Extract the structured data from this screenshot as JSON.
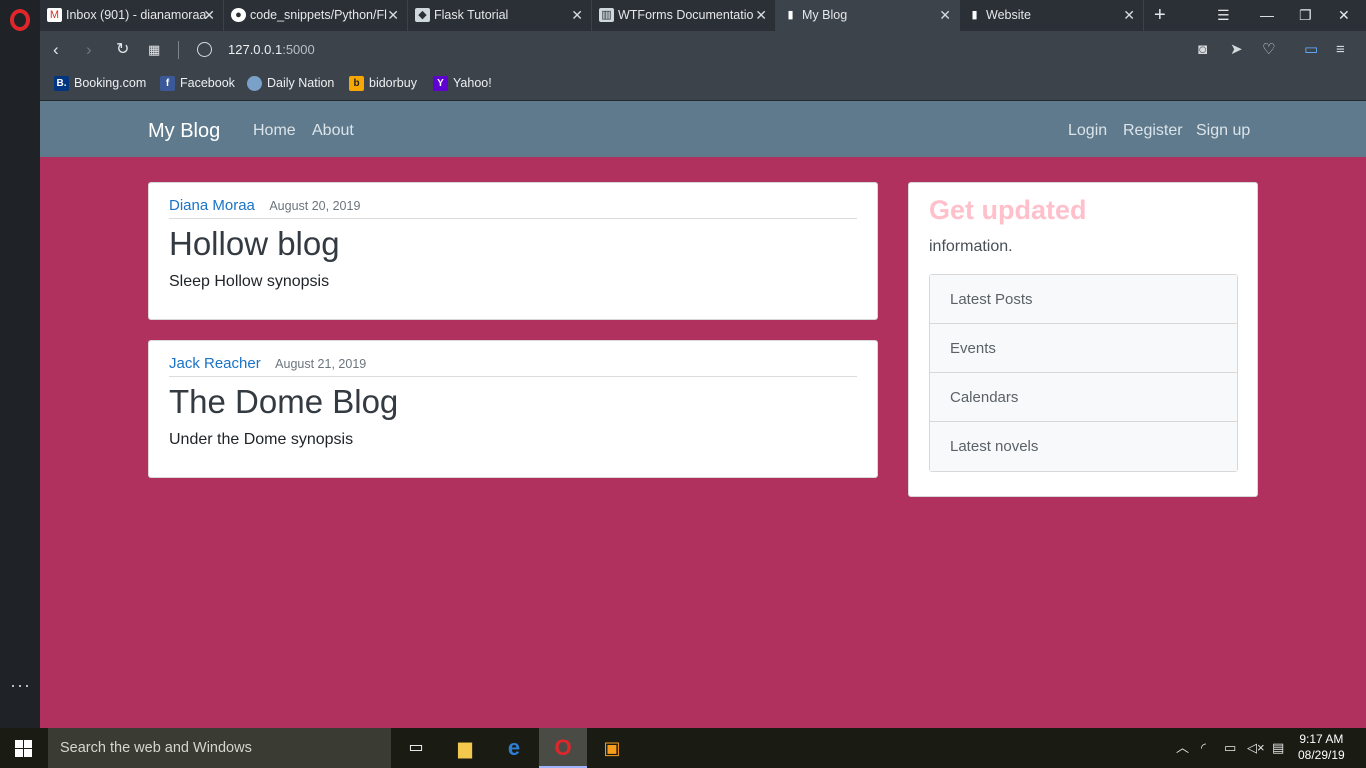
{
  "browser": {
    "tabs": [
      {
        "title": "Inbox (901) - dianamoraa",
        "icon": "gmail-icon",
        "icon_color": "#d93025"
      },
      {
        "title": "code_snippets/Python/Fl",
        "icon": "github-icon",
        "icon_color": "#ffffff"
      },
      {
        "title": "Flask Tutorial",
        "icon": "flask-icon",
        "icon_color": "#cfd8dc"
      },
      {
        "title": "WTForms Documentatio",
        "icon": "docs-icon",
        "icon_color": "#cfd8dc"
      },
      {
        "title": "My Blog",
        "icon": "page-icon",
        "icon_color": "#ffffff"
      },
      {
        "title": "Website",
        "icon": "page-icon",
        "icon_color": "#ffffff"
      }
    ],
    "url_host": "127.0.0.1",
    "url_port": ":5000",
    "bookmarks": [
      {
        "label": "Booking.com",
        "icon_text": "B.",
        "icon_color": "#003580"
      },
      {
        "label": "Facebook",
        "icon_text": "f",
        "icon_color": "#3b5998"
      },
      {
        "label": "Daily Nation",
        "icon_text": "",
        "icon_color": "#7aa2c8"
      },
      {
        "label": "bidorbuy",
        "icon_text": "b",
        "icon_color": "#f7a800"
      },
      {
        "label": "Yahoo!",
        "icon_text": "Y",
        "icon_color": "#5f01d1"
      }
    ]
  },
  "site": {
    "brand": "My Blog",
    "nav_left": [
      "Home",
      "About"
    ],
    "nav_right": [
      "Login",
      "Register",
      "Sign up"
    ],
    "posts": [
      {
        "author": "Diana Moraa",
        "date": "August 20, 2019",
        "title": "Hollow blog",
        "content": "Sleep Hollow synopsis"
      },
      {
        "author": "Jack Reacher",
        "date": "August 21, 2019",
        "title": "The Dome Blog",
        "content": "Under the Dome synopsis"
      }
    ],
    "sidebar": {
      "title": "Get updated",
      "text": "information.",
      "items": [
        "Latest Posts",
        "Events",
        "Calendars",
        "Latest novels"
      ]
    }
  },
  "taskbar": {
    "search_placeholder": "Search the web and Windows",
    "time": "9:17 AM",
    "date": "08/29/19"
  }
}
